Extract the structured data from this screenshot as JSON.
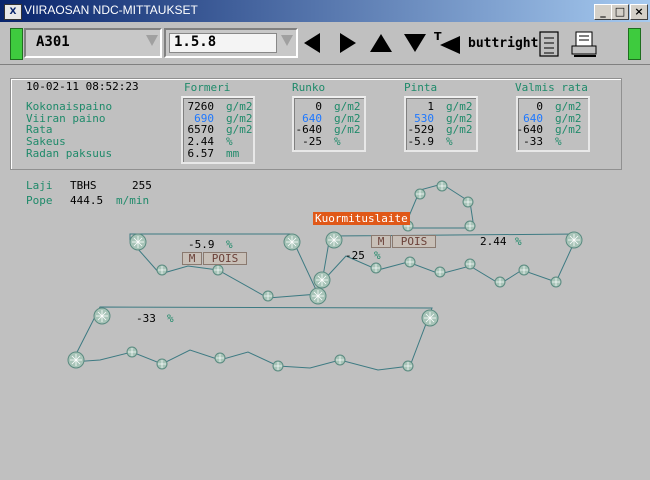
{
  "window": {
    "title": "VIIRAOSAN NDC-MITTAUKSET",
    "icon": "X"
  },
  "toolbar": {
    "combo1_value": "A301",
    "combo2_value": "1.5.8",
    "buttright_label": "buttright",
    "icons": [
      "arrow-left-icon",
      "arrow-right-icon",
      "arrow-up-icon",
      "arrow-down-icon",
      "text-left-icon",
      "document-icon",
      "printer-icon"
    ]
  },
  "datapanel": {
    "timestamp": "10-02-11 08:52:23",
    "row_labels": [
      "Kokonaispaino",
      "Viiran paino",
      "Rata",
      "Sakeus",
      "Radan paksuus"
    ],
    "columns": [
      {
        "name": "Formeri",
        "values": [
          "7260",
          "690",
          "6570",
          "2.44",
          "6.57"
        ],
        "units": [
          "g/m2",
          "g/m2",
          "g/m2",
          "%",
          "mm"
        ]
      },
      {
        "name": "Runko",
        "values": [
          "0",
          "640",
          "-640",
          "-25"
        ],
        "units": [
          "g/m2",
          "g/m2",
          "g/m2",
          "%"
        ]
      },
      {
        "name": "Pinta",
        "values": [
          "1",
          "530",
          "-529",
          "-5.9"
        ],
        "units": [
          "g/m2",
          "g/m2",
          "g/m2",
          "%"
        ]
      },
      {
        "name": "Valmis rata",
        "values": [
          "0",
          "640",
          "-640",
          "-33"
        ],
        "units": [
          "g/m2",
          "g/m2",
          "g/m2",
          "%"
        ]
      }
    ]
  },
  "info": {
    "laji_label": "Laji",
    "laji_value": "TBHS",
    "laji_number": "255",
    "pope_label": "Pope",
    "pope_value": "444.5",
    "pope_unit": "m/min"
  },
  "process": {
    "kuormitus_label": "Kuormituslaite",
    "upper_left": {
      "value": "-5.9",
      "unit": "%",
      "m_label": "M",
      "pois_label": "POIS"
    },
    "upper_right": {
      "value": "2.44",
      "unit": "%",
      "m_label": "M",
      "pois_label": "POIS"
    },
    "middle": {
      "value": "-25",
      "unit": "%"
    },
    "lower": {
      "value": "-33",
      "unit": "%"
    }
  },
  "colors": {
    "label": "#1f8a6a",
    "blue_value": "#1e78ff",
    "felt_line": "#3d7a82",
    "roll": "#9fbfb0",
    "kuormitus_bg": "#e05818"
  }
}
